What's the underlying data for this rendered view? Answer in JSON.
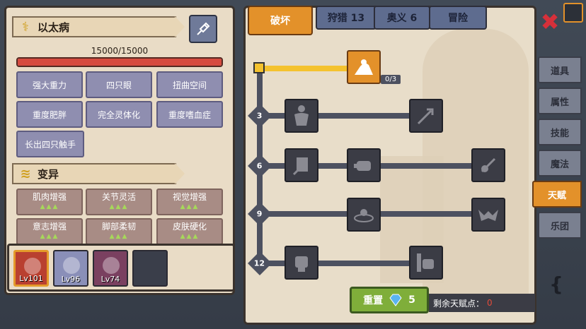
{
  "character": {
    "name": "以太病",
    "hp_text": "15000/15000",
    "hp_fraction": 1.0
  },
  "traits": [
    "强大重力",
    "四只眼",
    "扭曲空间",
    "重度肥胖",
    "完全灵体化",
    "重度嗜血症",
    "长出四只触手"
  ],
  "mutation": {
    "title": "变异",
    "items": [
      {
        "label": "肌肉增强",
        "marks": "▲▲▲"
      },
      {
        "label": "关节灵活",
        "marks": "▲▲▲"
      },
      {
        "label": "视觉增强",
        "marks": "▲▲▲"
      },
      {
        "label": "意志增强",
        "marks": "▲▲▲"
      },
      {
        "label": "脚部柔韧",
        "marks": "▲▲▲"
      },
      {
        "label": "皮肤硬化",
        "marks": "▲▲▲"
      }
    ]
  },
  "party": [
    {
      "level": "Lv101",
      "selected": true
    },
    {
      "level": "Lv96",
      "selected": false
    },
    {
      "level": "Lv74",
      "selected": false
    },
    {
      "level": "",
      "selected": false
    }
  ],
  "tabs": [
    {
      "label": "破坏",
      "active": true
    },
    {
      "label": "狩猎 13",
      "active": false
    },
    {
      "label": "奥义 6",
      "active": false
    },
    {
      "label": "冒险",
      "active": false
    }
  ],
  "tree": {
    "levels": [
      "3",
      "6",
      "9",
      "12"
    ],
    "top_node_count": "0/3"
  },
  "reset": {
    "label": "重置",
    "gems": "5"
  },
  "remaining": {
    "label": "剩余天赋点：",
    "value": "0"
  },
  "side_tabs": [
    "道具",
    "属性",
    "技能",
    "魔法",
    "天赋",
    "乐团"
  ],
  "side_active": "天赋",
  "colors": {
    "accent": "#e3912a",
    "hp": "#d64b3f",
    "trait_btn": "#8f8eb0",
    "mutation_btn": "#a88c85",
    "reset": "#7fae3a"
  },
  "icons": [
    "dna-icon",
    "syringe-icon",
    "arm-wrestle-icon",
    "muscle-body-icon",
    "arrow-hit-icon",
    "shield-slash-icon",
    "punch-icon",
    "blood-splash-icon",
    "portal-icon",
    "demon-wing-icon",
    "fist-icon",
    "fist-wall-icon",
    "gem-icon",
    "close-icon"
  ]
}
